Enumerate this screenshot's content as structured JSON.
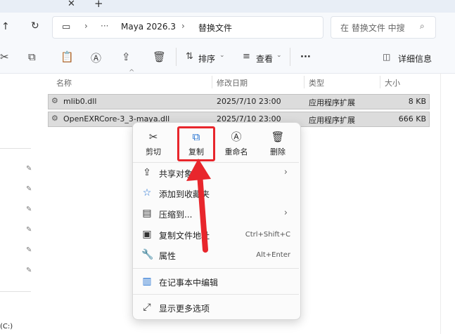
{
  "tabbar": {
    "close_icon": "close-icon",
    "add_icon": "plus-icon"
  },
  "address": {
    "crumbs": [
      "Maya 2026.3",
      "替换文件"
    ],
    "search_placeholder": "在 替换文件 中搜"
  },
  "toolbar": {
    "sort_label": "排序",
    "view_label": "查看",
    "more_label": "···",
    "details_label": "详细信息"
  },
  "columns": {
    "name": "名称",
    "date": "修改日期",
    "type": "类型",
    "size": "大小"
  },
  "files": [
    {
      "name": "mlib0.dll",
      "date": "2025/7/10 23:00",
      "type": "应用程序扩展",
      "size": "8 KB"
    },
    {
      "name": "OpenEXRCore-3_3-maya.dll",
      "date": "2025/7/10 23:00",
      "type": "应用程序扩展",
      "size": "666 KB"
    }
  ],
  "sidebar": {
    "drive_label": "(C:)"
  },
  "context_menu": {
    "quick_actions": [
      {
        "label": "剪切",
        "icon": "cut-icon"
      },
      {
        "label": "复制",
        "icon": "copy-icon"
      },
      {
        "label": "重命名",
        "icon": "rename-icon"
      },
      {
        "label": "删除",
        "icon": "trash-icon"
      }
    ],
    "items": [
      {
        "label": "共享对象",
        "shortcut": ""
      },
      {
        "label": "添加到收藏夹",
        "shortcut": ""
      },
      {
        "label": "压缩到...",
        "shortcut": ""
      },
      {
        "label": "复制文件地址",
        "shortcut": "Ctrl+Shift+C"
      },
      {
        "label": "属性",
        "shortcut": "Alt+Enter"
      },
      {
        "label": "在记事本中编辑",
        "shortcut": ""
      },
      {
        "label": "显示更多选项",
        "shortcut": ""
      }
    ]
  },
  "colors": {
    "highlight": "#e8262c",
    "selection": "#dcdcdc",
    "accent": "#1f6fd1"
  }
}
